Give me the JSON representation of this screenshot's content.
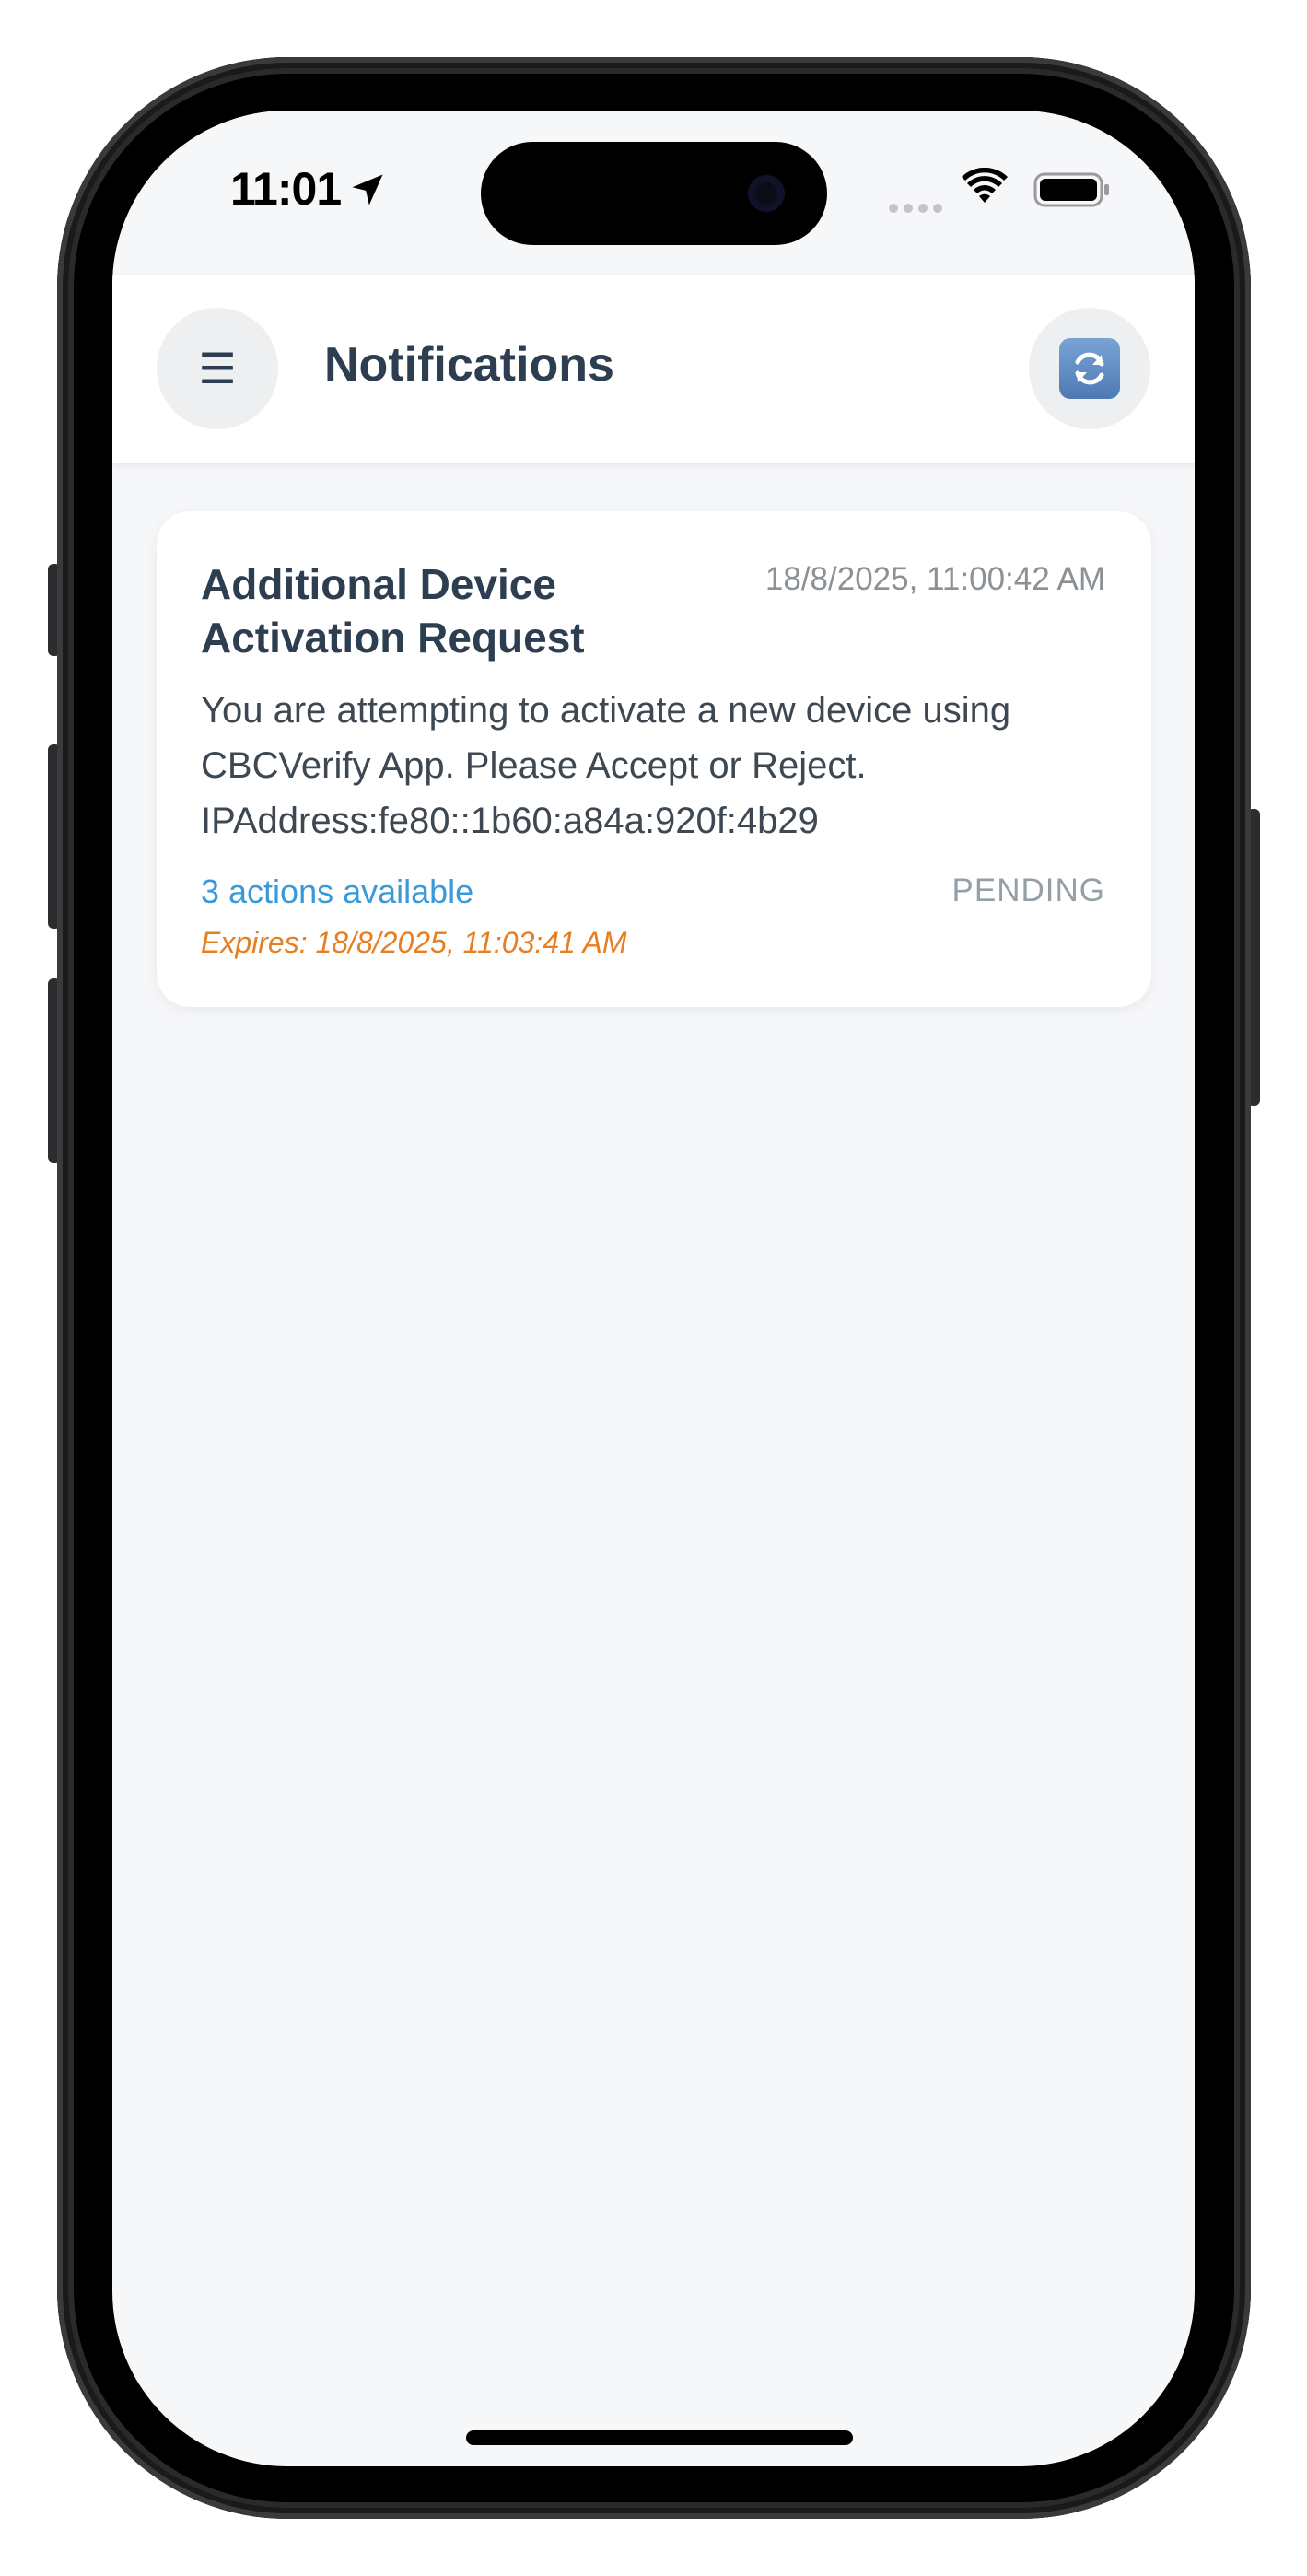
{
  "status_bar": {
    "time": "11:01",
    "location_icon": "location-arrow-icon",
    "signal_icon": "cellular-signal-icon",
    "wifi_icon": "wifi-icon",
    "battery_icon": "battery-icon"
  },
  "header": {
    "menu_icon": "☰",
    "title": "Notifications",
    "refresh_icon": "refresh-icon"
  },
  "notifications": [
    {
      "title": "Additional Device Activation Request",
      "timestamp": "18/8/2025, 11:00:42 AM",
      "message": "You are attempting to activate a new device using CBCVerify App. Please Accept or Reject. IPAddress:fe80::1b60:a84a:920f:4b29",
      "actions_label": "3 actions available",
      "status": "PENDING",
      "expires": "Expires: 18/8/2025, 11:03:41 AM"
    }
  ],
  "colors": {
    "title_text": "#2c3e50",
    "link": "#3a99d8",
    "expires": "#e67e22",
    "status": "#95a0a6",
    "screen_bg": "#f6f7f9"
  }
}
